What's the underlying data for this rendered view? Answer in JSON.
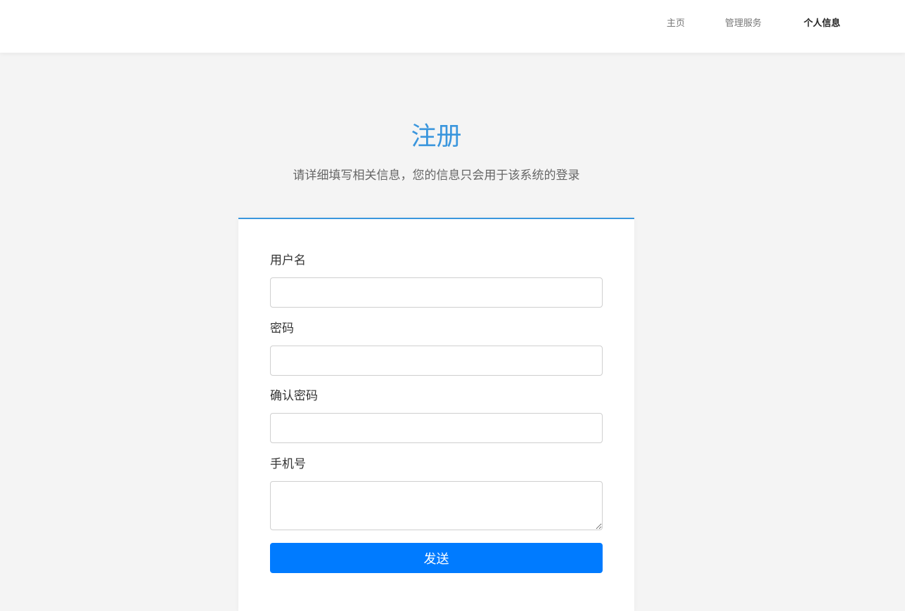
{
  "nav": {
    "home": "主页",
    "manage": "管理服务",
    "profile": "个人信息"
  },
  "header": {
    "title": "注册",
    "subtitle": "请详细填写相关信息，您的信息只会用于该系统的登录"
  },
  "form": {
    "username_label": "用户名",
    "username_value": "",
    "password_label": "密码",
    "password_value": "",
    "confirm_label": "确认密码",
    "confirm_value": "",
    "phone_label": "手机号",
    "phone_value": "",
    "submit_label": "发送"
  },
  "colors": {
    "accent": "#3a96dd",
    "button": "#007bff",
    "background": "#f4f4f4"
  }
}
